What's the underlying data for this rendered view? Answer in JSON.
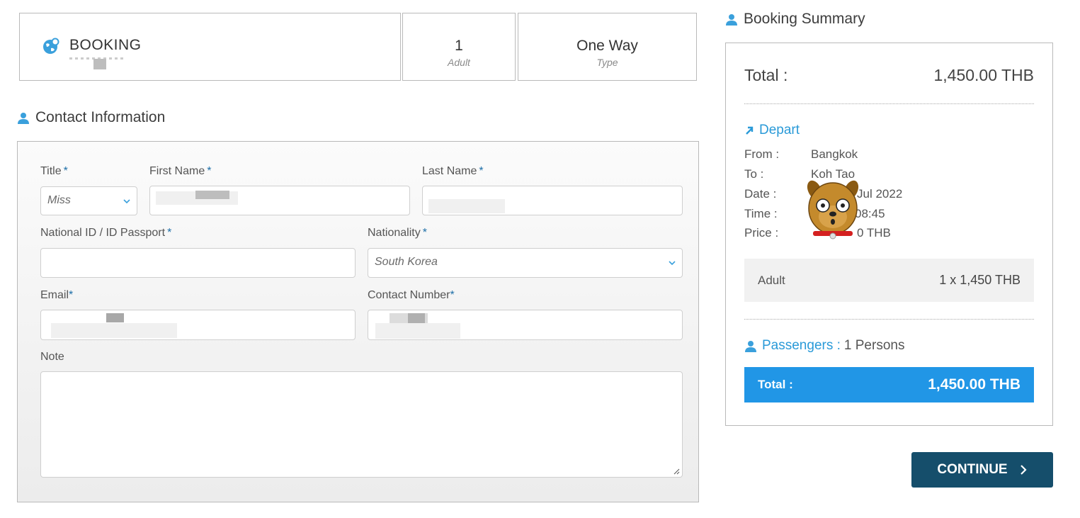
{
  "booking": {
    "title": "BOOKING",
    "icon": "globe-icon"
  },
  "adult": {
    "value": "1",
    "label": "Adult"
  },
  "trip_type": {
    "value": "One Way",
    "label": "Type"
  },
  "contact": {
    "heading": "Contact Information",
    "title_label": "Title",
    "title_value": "Miss",
    "first_name_label": "First Name",
    "last_name_label": "Last Name",
    "national_id_label": "National ID / ID Passport",
    "nationality_label": "Nationality",
    "nationality_value": "South Korea",
    "email_label": "Email",
    "contact_number_label": "Contact Number",
    "note_label": "Note",
    "required_mark": "*"
  },
  "summary": {
    "heading": "Booking Summary",
    "total_label": "Total :",
    "total_value": "1,450.00 THB",
    "depart_label": "Depart",
    "from_label": "From :",
    "from_value": "Bangkok",
    "to_label": "To :",
    "to_value": "Koh Tao",
    "date_label": "Date :",
    "date_value": "Jul 2022",
    "time_label": "Time :",
    "time_value": "08:45",
    "price_label": "Price :",
    "price_value": "0 THB",
    "adult_label": "Adult",
    "adult_value": "1 x 1,450 THB",
    "passengers_label": "Passengers :",
    "passengers_value": "1 Persons",
    "bar_total_label": "Total :",
    "bar_total_value": "1,450.00 THB"
  },
  "actions": {
    "continue_label": "CONTINUE"
  },
  "colors": {
    "accent": "#2a9ad8",
    "total_bar": "#2196e6",
    "continue_bg": "#154e6b",
    "required": "#1e6fa8"
  }
}
